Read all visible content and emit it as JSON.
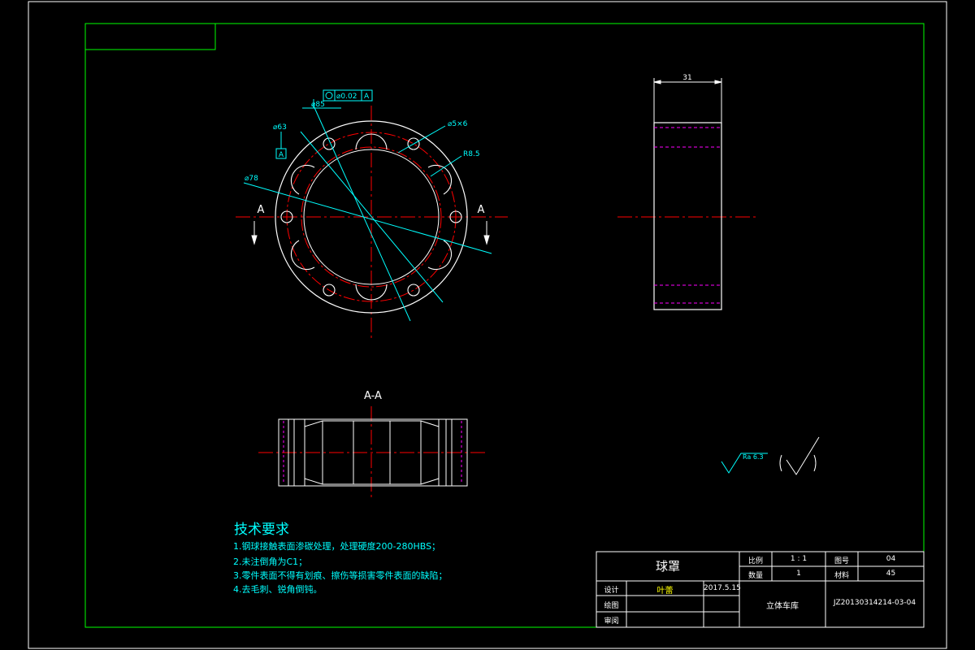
{
  "drawing": {
    "section_label": "A-A",
    "section_mark_left": "A",
    "section_mark_right": "A",
    "datum_label": "A",
    "tolerance_value": "⌀0.02",
    "tolerance_datum": "A",
    "dim_phi85": "⌀85",
    "dim_phi63": "⌀63",
    "dim_phi78": "⌀78",
    "dim_hole": "⌀5×6",
    "dim_r": "R8.5",
    "dim_width": "31",
    "roughness": "Ra 6.3"
  },
  "tech_requirements": {
    "heading": "技术要求",
    "items": [
      "1.钢球接触表面渗碳处理，处理硬度200-280HBS；",
      "2.未注倒角为C1；",
      "3.零件表面不得有划痕、擦伤等损害零件表面的缺陷；",
      "4.去毛刺、锐角倒钝。"
    ]
  },
  "title_block": {
    "part_name": "球罩",
    "scale_label": "比例",
    "scale_value": "1 : 1",
    "drawing_no_label": "图号",
    "drawing_no_value": "04",
    "quantity_label": "数量",
    "quantity_value": "1",
    "material_label": "材料",
    "material_value": "45",
    "design_label": "设计",
    "designer": "叶蕾",
    "design_date": "2017.5.15",
    "drawn_label": "绘图",
    "review_label": "审阅",
    "project": "立体车库",
    "code": "JZ20130314214-03-04"
  },
  "colors": {
    "frame": "#00ff00",
    "outline": "#ffffff",
    "center": "#ff0000",
    "dimension": "#00ffff",
    "hidden": "#ff00ff",
    "note": "#00ffff",
    "title_text": "#ffffff",
    "designer_text": "#ffff00"
  }
}
